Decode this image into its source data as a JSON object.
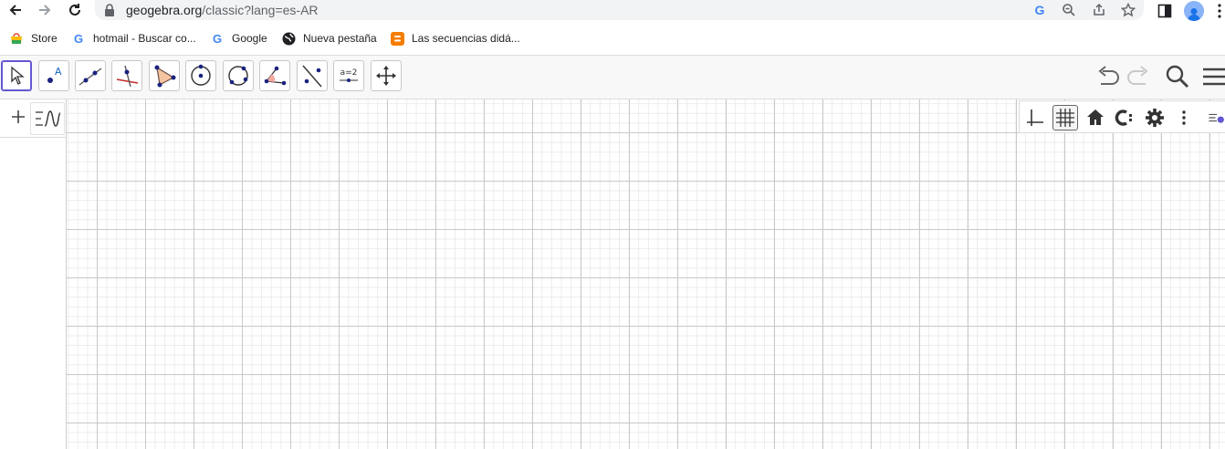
{
  "browser": {
    "url_host": "geogebra.org",
    "url_path": "/classic?lang=es-AR",
    "bookmarks": [
      {
        "label": "Store",
        "icon": "store-icon"
      },
      {
        "label": "hotmail - Buscar co...",
        "icon": "google-icon"
      },
      {
        "label": "Google",
        "icon": "google-icon"
      },
      {
        "label": "Nueva pestaña",
        "icon": "globe-icon"
      },
      {
        "label": "Las secuencias didá...",
        "icon": "blogger-icon"
      }
    ]
  },
  "toolbar": {
    "tools": [
      {
        "name": "move-tool",
        "active": true
      },
      {
        "name": "point-tool"
      },
      {
        "name": "line-tool"
      },
      {
        "name": "perpendicular-line-tool"
      },
      {
        "name": "polygon-tool"
      },
      {
        "name": "circle-center-point-tool"
      },
      {
        "name": "circle-three-points-tool"
      },
      {
        "name": "angle-tool"
      },
      {
        "name": "reflect-tool"
      },
      {
        "name": "slider-tool",
        "label": "a=2"
      },
      {
        "name": "move-graphics-view-tool"
      }
    ],
    "right": [
      "undo-icon",
      "redo-icon",
      "search-icon",
      "menu-icon"
    ]
  },
  "style_bar": {
    "buttons": [
      "axes-icon",
      "grid-icon",
      "home-icon",
      "label-style-icon",
      "gear-icon",
      "more-icon",
      "style-bar-toggle-icon"
    ]
  },
  "colors": {
    "active_tool_border": "#6557d2",
    "geogebra_point": "#1565c0",
    "grid_major": "#c9c9c9",
    "grid_minor": "#ececec"
  }
}
